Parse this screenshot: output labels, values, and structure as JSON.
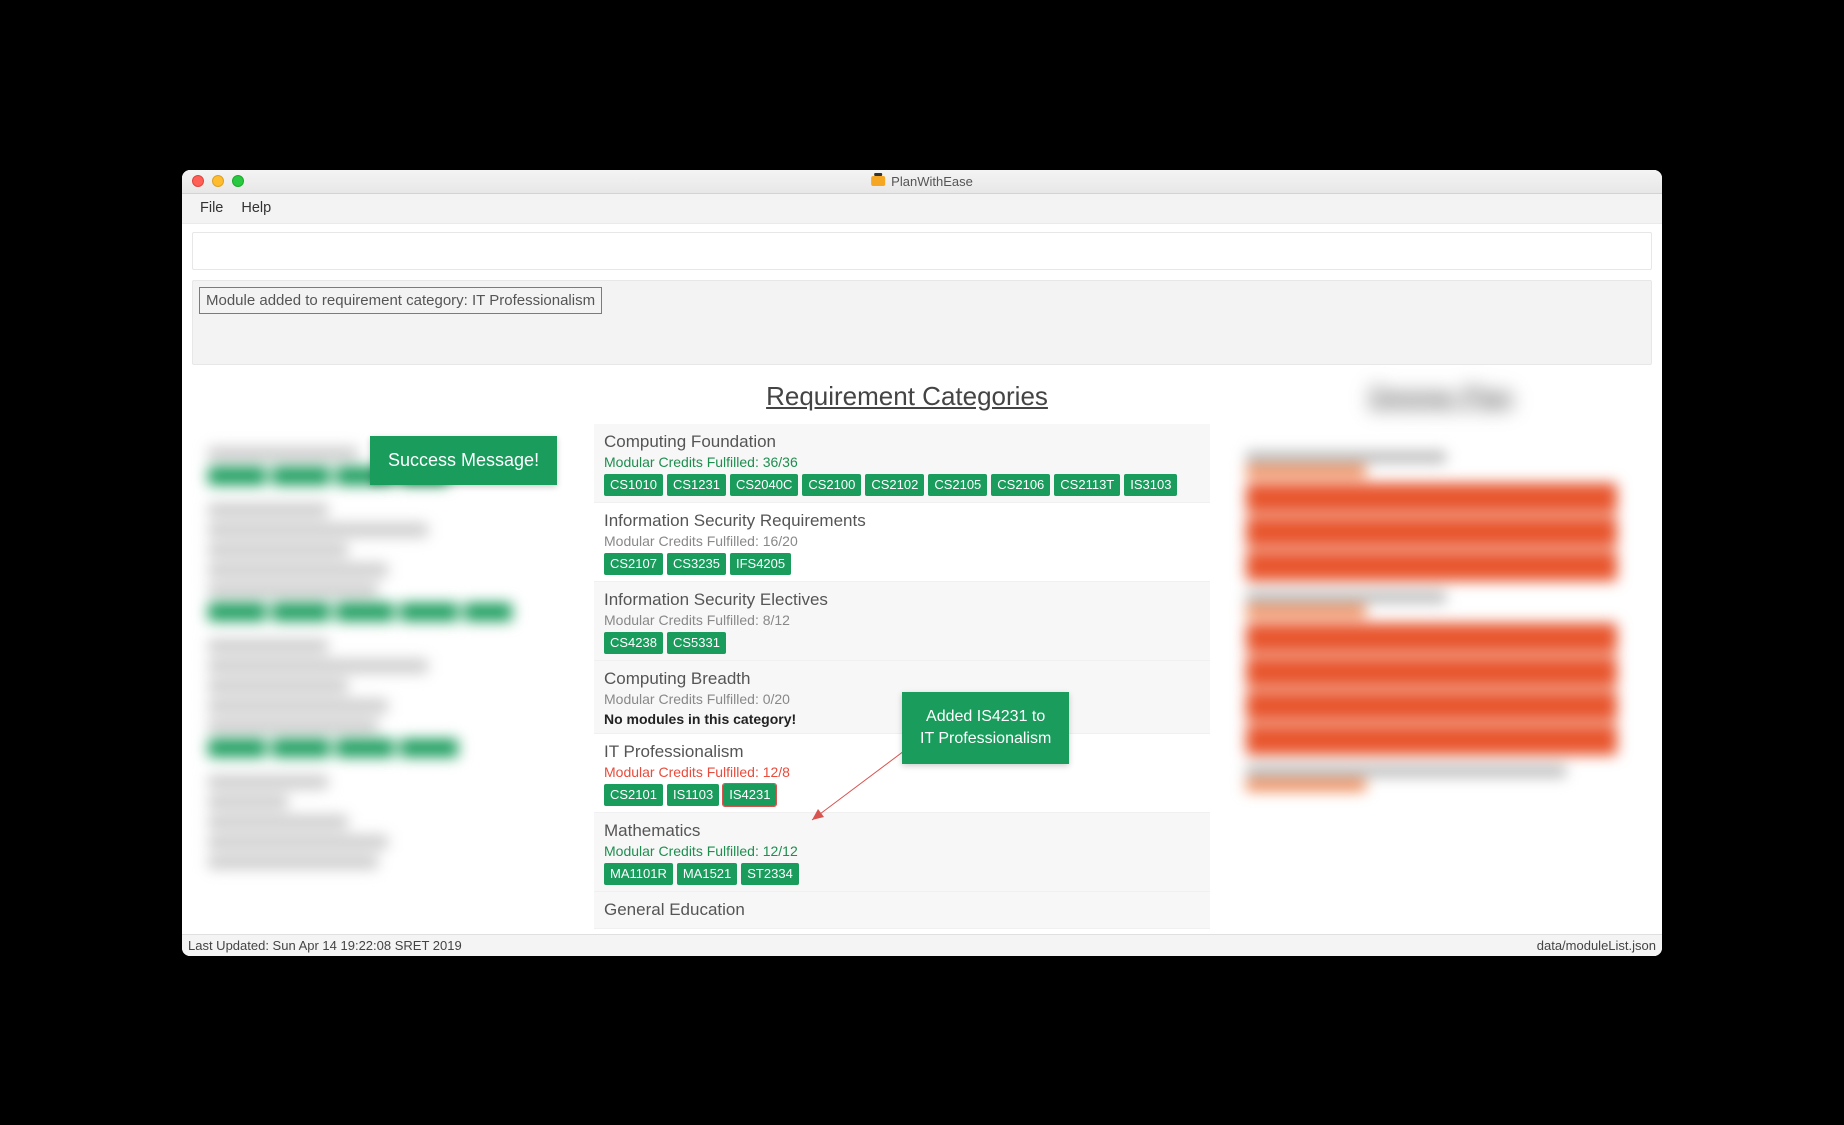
{
  "app_title": "PlanWithEase",
  "menu": {
    "file": "File",
    "help": "Help"
  },
  "message": "Module added to requirement category: IT Professionalism",
  "callouts": {
    "success": "Success Message!",
    "added_prefix": "Added ",
    "added_module": "IS4231",
    "added_mid": " to",
    "added_target": "IT Professionalism"
  },
  "center": {
    "title": "Requirement Categories",
    "categories": [
      {
        "name": "Computing Foundation",
        "credits_label": "Modular Credits Fulfilled: 36/36",
        "credits_style": "green",
        "alt": true,
        "modules": [
          "CS1010",
          "CS1231",
          "CS2040C",
          "CS2100",
          "CS2102",
          "CS2105",
          "CS2106",
          "CS2113T",
          "IS3103"
        ]
      },
      {
        "name": "Information Security Requirements",
        "credits_label": "Modular Credits Fulfilled: 16/20",
        "credits_style": "gray",
        "alt": false,
        "modules": [
          "CS2107",
          "CS3235",
          "IFS4205"
        ]
      },
      {
        "name": "Information Security Electives",
        "credits_label": "Modular Credits Fulfilled: 8/12",
        "credits_style": "gray",
        "alt": true,
        "modules": [
          "CS4238",
          "CS5331"
        ]
      },
      {
        "name": "Computing Breadth",
        "credits_label": "Modular Credits Fulfilled: 0/20",
        "credits_style": "gray",
        "alt": true,
        "no_modules": "No modules in this category!"
      },
      {
        "name": "IT Professionalism",
        "credits_label": "Modular Credits Fulfilled: 12/8",
        "credits_style": "red",
        "alt": false,
        "modules": [
          "CS2101",
          "IS1103",
          "IS4231"
        ],
        "highlight_last": true
      },
      {
        "name": "Mathematics",
        "credits_label": "Modular Credits Fulfilled: 12/12",
        "credits_style": "green",
        "alt": true,
        "modules": [
          "MA1101R",
          "MA1521",
          "ST2334"
        ]
      },
      {
        "name": "General Education",
        "credits_label": "",
        "credits_style": "gray",
        "alt": true,
        "modules": []
      }
    ]
  },
  "right": {
    "title": "Degree Plan"
  },
  "status": {
    "left": "Last Updated: Sun Apr 14 19:22:08 SRET 2019",
    "right": "data/moduleList.json"
  }
}
